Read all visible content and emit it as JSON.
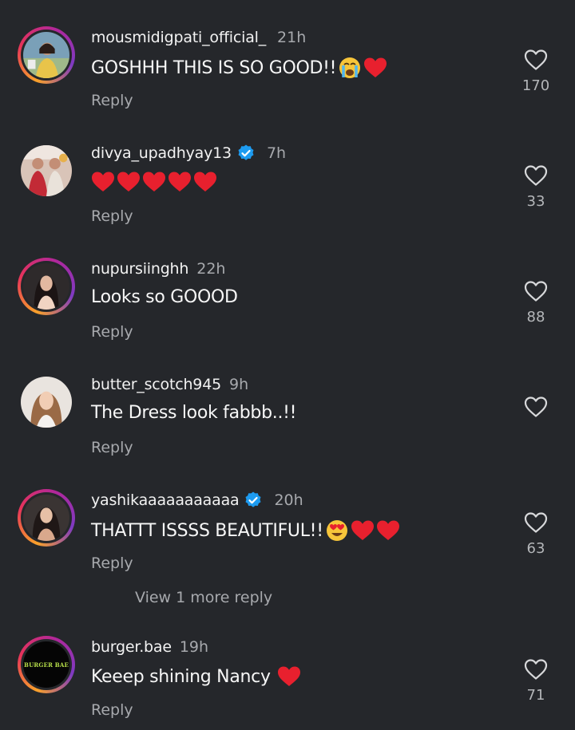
{
  "colors": {
    "background": "#25272b",
    "verified": "#1d9bf0",
    "heart": "#e8202e"
  },
  "comments": [
    {
      "username": "mousmidigpati_official_",
      "time": "21h",
      "text": "GOSHHH THIS IS SO GOOD!!",
      "emojis": [
        "loudly-crying-face",
        "red-heart"
      ],
      "reply": "Reply",
      "likes": "170",
      "verified": false,
      "story_ring": true
    },
    {
      "username": "divya_upadhyay13",
      "time": "7h",
      "text": "",
      "emojis": [
        "red-heart",
        "red-heart",
        "red-heart",
        "red-heart",
        "red-heart"
      ],
      "reply": "Reply",
      "likes": "33",
      "verified": true,
      "story_ring": false
    },
    {
      "username": "nupursiinghh",
      "time": "22h",
      "text": "Looks so GOOOD",
      "emojis": [],
      "reply": "Reply",
      "likes": "88",
      "verified": false,
      "story_ring": true
    },
    {
      "username": "butter_scotch945",
      "time": "9h",
      "text": "The Dress look fabbb..!!",
      "emojis": [],
      "reply": "Reply",
      "likes": "",
      "verified": false,
      "story_ring": false
    },
    {
      "username": "yashikaaaaaaaaaaa",
      "time": "20h",
      "text": "THATTT ISSSS BEAUTIFUL!!",
      "emojis": [
        "heart-eyes-face",
        "red-heart",
        "red-heart"
      ],
      "reply": "Reply",
      "likes": "63",
      "verified": true,
      "story_ring": true
    },
    {
      "username": "burger.bae",
      "time": "19h",
      "text": "Keeep shining Nancy",
      "emojis": [
        "red-heart"
      ],
      "reply": "Reply",
      "likes": "71",
      "verified": false,
      "story_ring": true,
      "avatar_text": "BURGER BAE"
    }
  ],
  "view_more_replies": "View 1 more reply"
}
